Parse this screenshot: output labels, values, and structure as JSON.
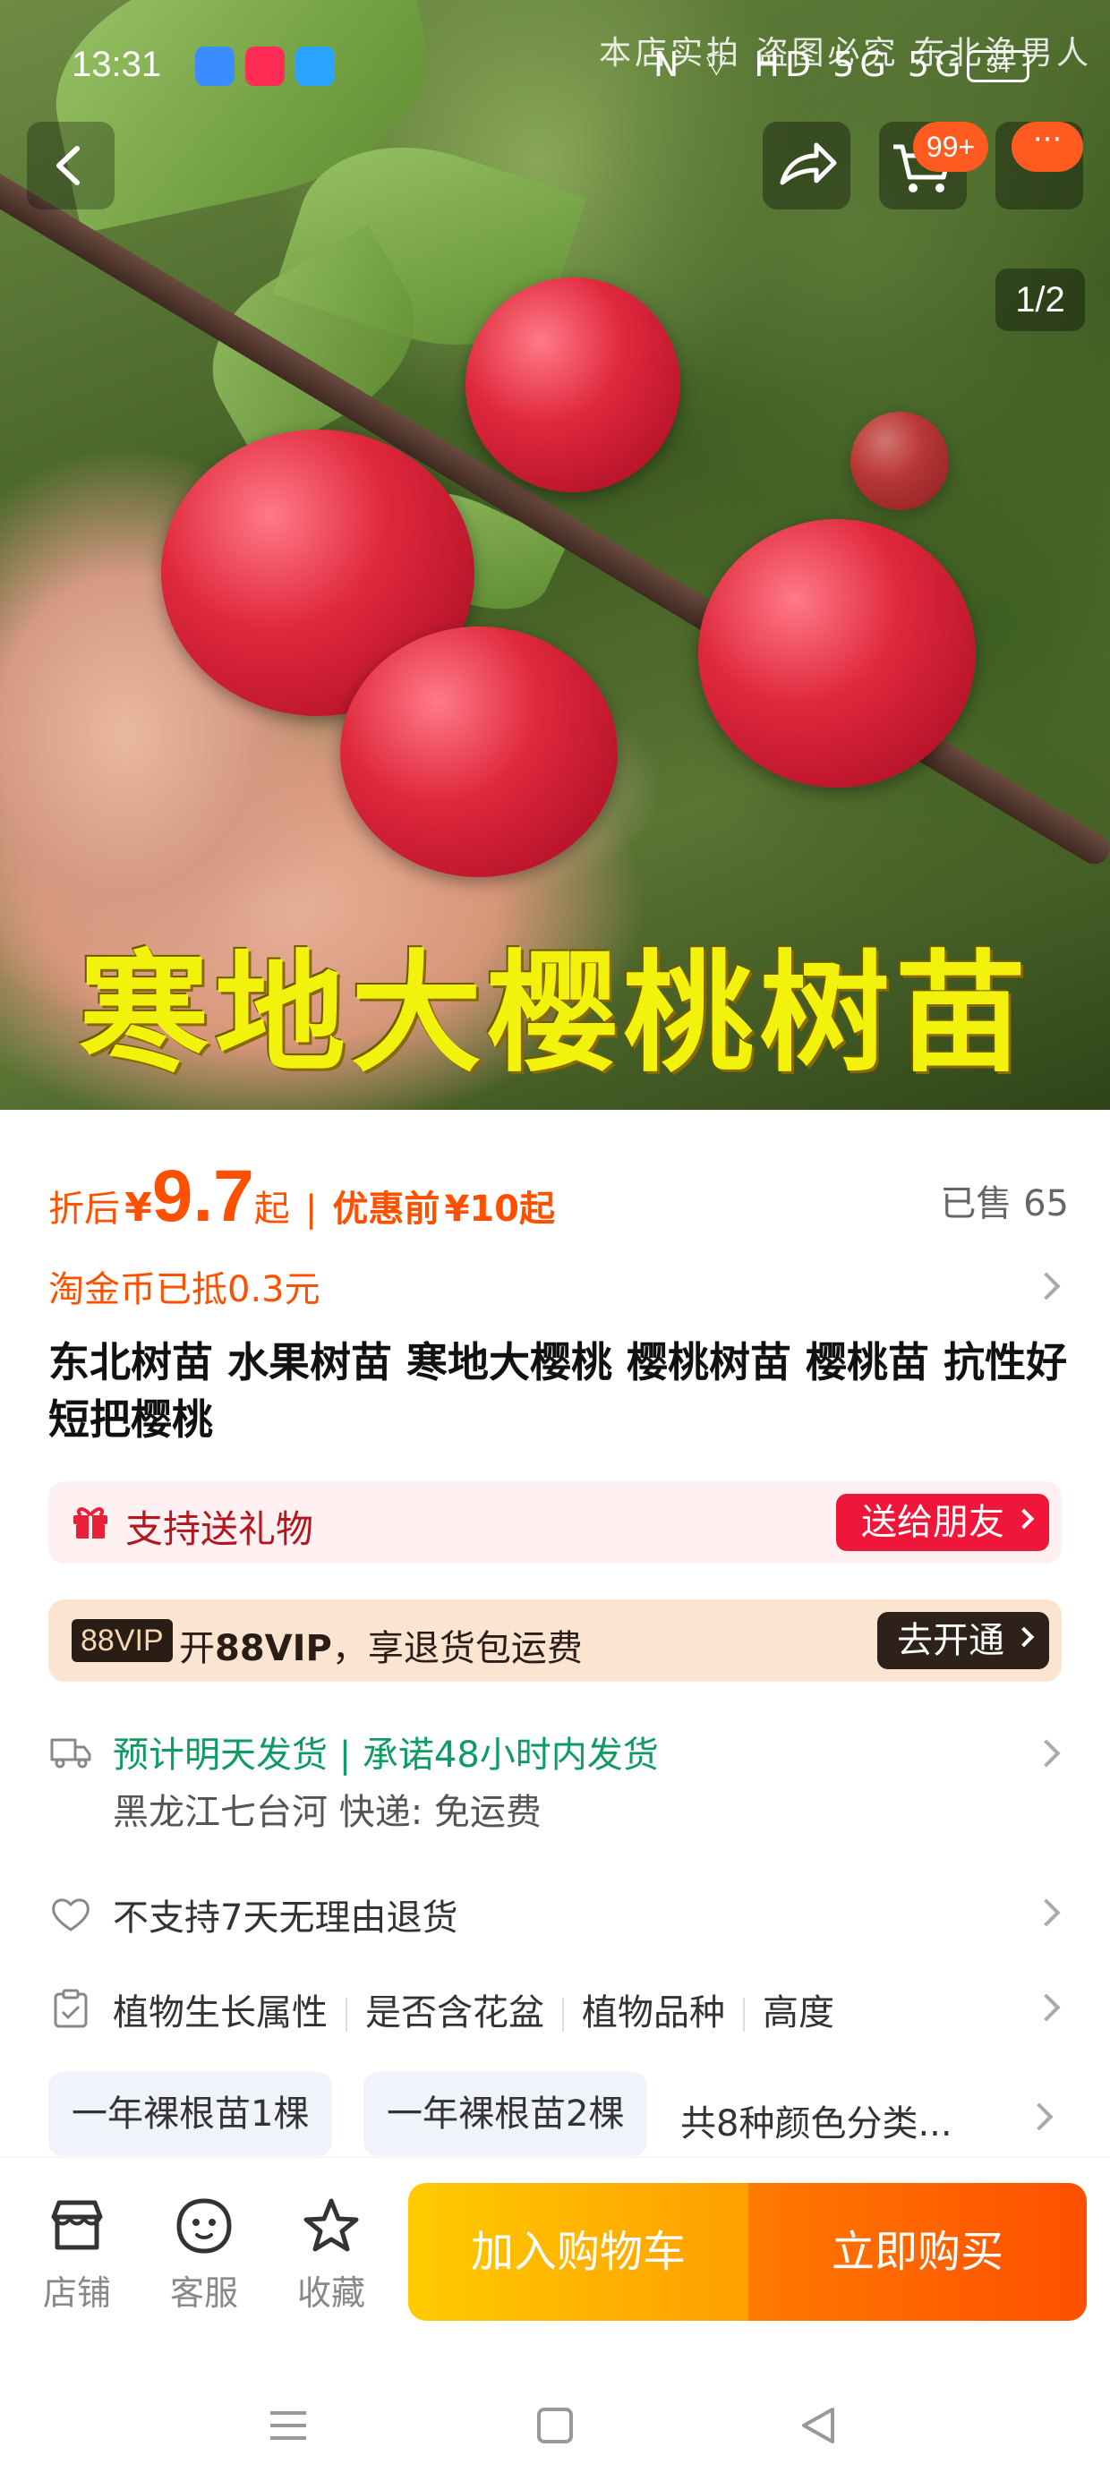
{
  "status_bar": {
    "time": "13:31",
    "indicators": "N ⌔ HD 5G 5G",
    "battery": "34"
  },
  "hero": {
    "caption": "寒地大樱桃树苗",
    "watermark": "本店实拍 盗图必究 东北渔男人",
    "pager": "1/2",
    "cart_badge": "99+",
    "more_pill": "···"
  },
  "price": {
    "after_label": "折后",
    "currency": "¥",
    "after_value": "9.7",
    "after_suffix": "起",
    "separator": "|",
    "before_label": "优惠前",
    "before_value": "¥10起",
    "sold": "已售 65"
  },
  "coin": {
    "text": "淘金币已抵0.3元"
  },
  "product": {
    "title": "东北树苗 水果树苗 寒地大樱桃 樱桃树苗 樱桃苗 抗性好 短把樱桃"
  },
  "gift": {
    "text": "支持送礼物",
    "button": "送给朋友"
  },
  "vip": {
    "tag": "88VIP",
    "text_prefix": "开",
    "text_bold": "88VIP",
    "text_rest": "，享退货包运费",
    "button": "去开通"
  },
  "shipping": {
    "main": "预计明天发货 | 承诺48小时内发货",
    "sub": "黑龙江七台河  快递:  免运费"
  },
  "returns": {
    "text": "不支持7天无理由退货"
  },
  "attributes": [
    "植物生长属性",
    "是否含花盆",
    "植物品种",
    "高度"
  ],
  "sku": {
    "options": [
      "一年裸根苗1棵",
      "一年裸根苗2棵"
    ],
    "more": "共8种颜色分类..."
  },
  "bottom": {
    "shop": "店铺",
    "service": "客服",
    "favorite": "收藏",
    "add_to_cart": "加入购物车",
    "buy_now": "立即购买"
  },
  "colors": {
    "accent": "#ff5000",
    "gift_red": "#f0163a",
    "ship_green": "#0e9c63",
    "vip_dark": "#2e2119"
  },
  "icons": [
    "back-icon",
    "share-icon",
    "cart-icon",
    "more-icon",
    "gift-icon",
    "truck-icon",
    "shield-icon",
    "clipboard-icon",
    "shop-icon",
    "service-icon",
    "star-icon",
    "chevron-right-icon"
  ]
}
